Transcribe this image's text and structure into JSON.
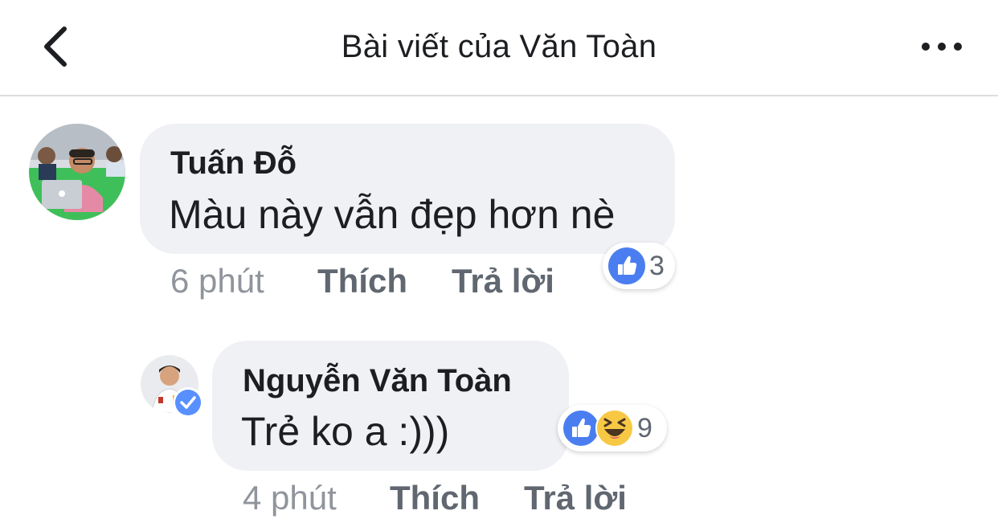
{
  "header": {
    "title": "Bài viết của Văn Toàn",
    "back_icon": "chevron-left-icon",
    "more_icon": "more-horizontal-icon"
  },
  "comments": [
    {
      "author": "Tuấn Đỗ",
      "text": "Màu này vẫn đẹp hơn nè",
      "time": "6 phút",
      "like_label": "Thích",
      "reply_label": "Trả lời",
      "reactions": [
        "like"
      ],
      "reaction_count": "3"
    },
    {
      "author": "Nguyễn Văn Toàn",
      "text": "Trẻ ko a :)))",
      "time": "4 phút",
      "like_label": "Thích",
      "reply_label": "Trả lời",
      "verified": true,
      "reactions": [
        "like",
        "haha"
      ],
      "reaction_count": "9"
    }
  ],
  "colors": {
    "like_blue": "#4a7ef0",
    "haha_yellow": "#f7c844",
    "bubble_bg": "#f0f1f4",
    "verified_blue": "#5890ff"
  }
}
